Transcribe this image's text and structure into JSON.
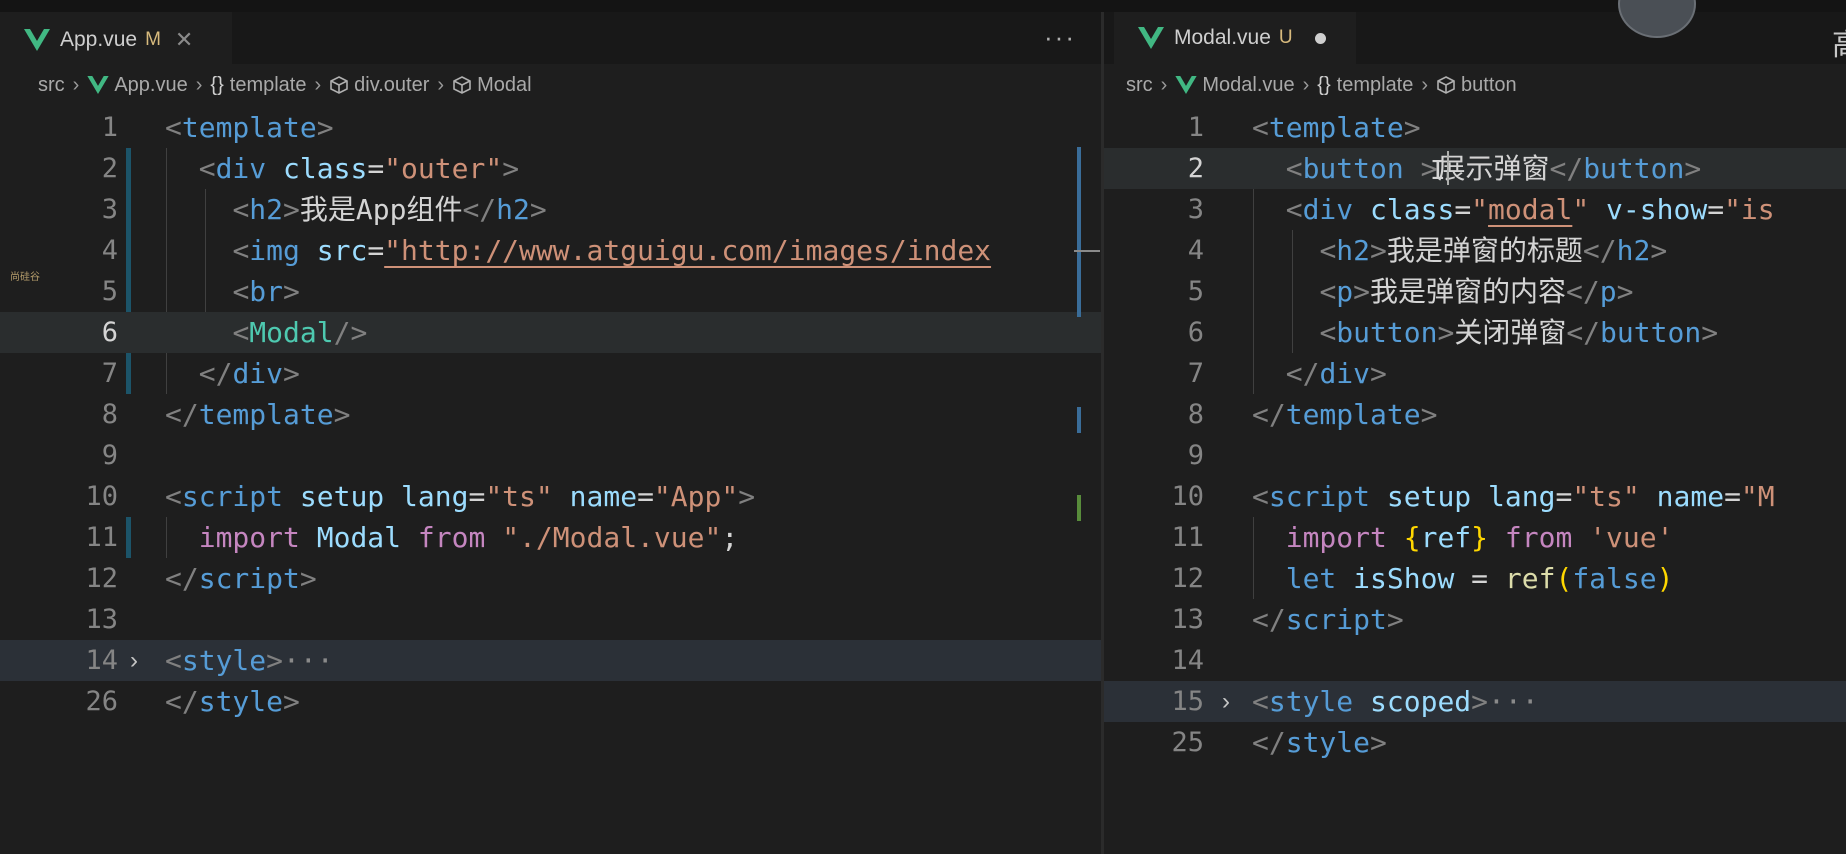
{
  "left_editor": {
    "tab": {
      "filename": "App.vue",
      "status": "M",
      "close": "✕"
    },
    "more_actions": "···",
    "breadcrumb": {
      "src": "src",
      "file": "App.vue",
      "template": "template",
      "outer": "div.outer",
      "modal": "Modal"
    },
    "lines": [
      {
        "num": "1"
      },
      {
        "num": "2"
      },
      {
        "num": "3"
      },
      {
        "num": "4"
      },
      {
        "num": "5"
      },
      {
        "num": "6"
      },
      {
        "num": "7"
      },
      {
        "num": "8"
      },
      {
        "num": "9"
      },
      {
        "num": "10"
      },
      {
        "num": "11"
      },
      {
        "num": "12"
      },
      {
        "num": "13"
      },
      {
        "num": "14"
      },
      {
        "num": "26"
      }
    ],
    "code": {
      "l1_tag": "template",
      "l2_tag": "div",
      "l2_attr": "class",
      "l2_val": "\"outer\"",
      "l3_tag": "h2",
      "l3_text": "我是App组件",
      "l4_tag": "img",
      "l4_attr": "src",
      "l4_val": "\"http://www.atguigu.com/images/index",
      "l5_tag": "br",
      "l6_comp": "Modal",
      "l7_tag": "div",
      "l8_tag": "template",
      "l10_tag": "script",
      "l10_a1": "setup",
      "l10_a2": "lang",
      "l10_v2": "\"ts\"",
      "l10_a3": "name",
      "l10_v3": "\"App\"",
      "l11_kw1": "import",
      "l11_id": "Modal",
      "l11_kw2": "from",
      "l11_str": "\"./Modal.vue\"",
      "l11_semi": ";",
      "l12_tag": "script",
      "l14_tag": "style",
      "l14_ellipsis": "···",
      "l26_tag": "style"
    }
  },
  "right_editor": {
    "tab": {
      "filename": "Modal.vue",
      "status": "U"
    },
    "breadcrumb": {
      "src": "src",
      "file": "Modal.vue",
      "template": "template",
      "button": "button"
    },
    "lines": [
      {
        "num": "1"
      },
      {
        "num": "2"
      },
      {
        "num": "3"
      },
      {
        "num": "4"
      },
      {
        "num": "5"
      },
      {
        "num": "6"
      },
      {
        "num": "7"
      },
      {
        "num": "8"
      },
      {
        "num": "9"
      },
      {
        "num": "10"
      },
      {
        "num": "11"
      },
      {
        "num": "12"
      },
      {
        "num": "13"
      },
      {
        "num": "14"
      },
      {
        "num": "15"
      },
      {
        "num": "25"
      }
    ],
    "code": {
      "l1_tag": "template",
      "l2_tag": "button",
      "l2_text": "展示弹窗",
      "l3_tag": "div",
      "l3_attr": "class",
      "l3_val": "modal",
      "l3_attr2": "v-show",
      "l3_val2": "\"is",
      "l4_tag": "h2",
      "l4_text": "我是弹窗的标题",
      "l5_tag": "p",
      "l5_text": "我是弹窗的内容",
      "l6_tag": "button",
      "l6_text": "关闭弹窗",
      "l7_tag": "div",
      "l8_tag": "template",
      "l10_tag": "script",
      "l10_a1": "setup",
      "l10_a2": "lang",
      "l10_v2": "\"ts\"",
      "l10_a3": "name",
      "l10_v3": "\"M",
      "l11_kw1": "import",
      "l11_id": "ref",
      "l11_kw2": "from",
      "l11_str": "'vue'",
      "l12_kw": "let",
      "l12_var": "isShow",
      "l12_fn": "ref",
      "l12_arg": "false",
      "l13_tag": "script",
      "l15_tag": "style",
      "l15_attr": "scoped",
      "l15_ellipsis": "···",
      "l25_tag": "style"
    }
  },
  "corner_glyph": "高",
  "watermark": "尚硅谷",
  "colors": {
    "tag": "#569cd6",
    "component": "#4ec9b0",
    "attribute": "#9cdcfe",
    "string": "#ce9178",
    "keyword": "#c586c0",
    "function": "#dcdcaa",
    "vue_green": "#41b883"
  }
}
